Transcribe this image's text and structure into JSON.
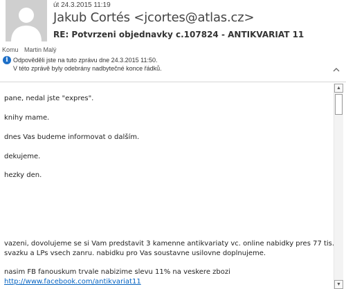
{
  "header": {
    "date": "út 24.3.2015 11:19",
    "sender": "Jakub Cortés <jcortes@atlas.cz>",
    "subject": "RE: Potvrzeni objednavky c.107824 - ANTIKVARIAT 11",
    "to_label": "Komu",
    "to_value": "Martin Malý",
    "info_replied": "Odpověděli jste na tuto zprávu dne 24.3.2015 11:50.",
    "info_linebreaks": "V této zprávě byly odebrány nadbytečné konce řádků.",
    "info_icon": "info-icon",
    "collapse_icon": "chevron-up-icon"
  },
  "body": {
    "lines": [
      "pane, nedal jste \"expres\".",
      "knihy mame.",
      "dnes Vas budeme informovat o dalším.",
      "dekujeme.",
      "hezky den.",
      "vazeni, dovolujeme se si Vam predstavit 3 kamenne antikvariaty vc. online nabidky pres 77 tis.",
      "svazku a LPs vsech zanru. nabidku pro Vas soustavne usilovne doplnujeme.",
      "nasim FB fanouskum trvale nabizime slevu 11% na veskere zbozi"
    ],
    "link": "http://www.facebook.com/antikvariat11"
  },
  "colors": {
    "link": "#0563c1",
    "info_icon": "#1e6fc7",
    "avatar_bg": "#cfcfcf"
  }
}
